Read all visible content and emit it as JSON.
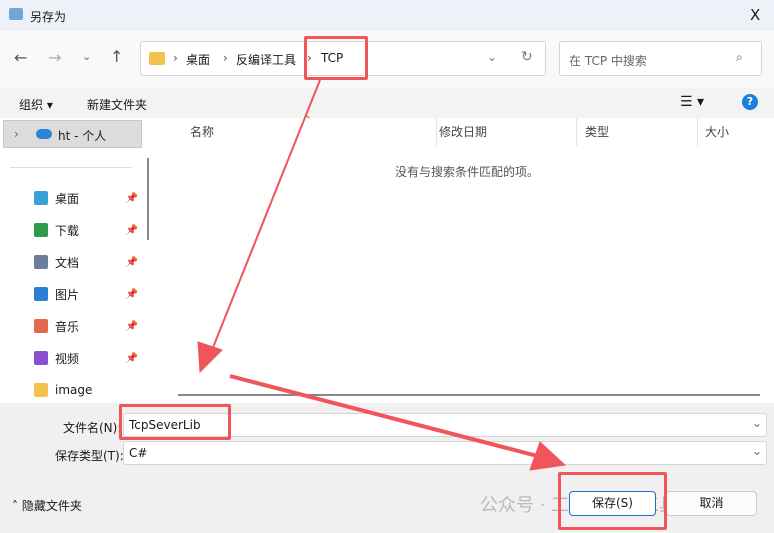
{
  "window": {
    "title": "另存为",
    "close": "X"
  },
  "nav": {
    "breadcrumb": [
      "桌面",
      "反编译工具",
      "TCP"
    ],
    "search_placeholder": "在 TCP 中搜索"
  },
  "toolbar": {
    "organize": "组织 ▾",
    "new_folder": "新建文件夹",
    "help": "?"
  },
  "sidebar": {
    "onedrive": "ht - 个人",
    "items": [
      {
        "label": "桌面",
        "icon": "desktop-icon",
        "color": "#3aa0d8"
      },
      {
        "label": "下载",
        "icon": "download-icon",
        "color": "#2e9a4a"
      },
      {
        "label": "文档",
        "icon": "document-icon",
        "color": "#6a7f9a"
      },
      {
        "label": "图片",
        "icon": "pictures-icon",
        "color": "#2b7fd4"
      },
      {
        "label": "音乐",
        "icon": "music-icon",
        "color": "#e0694f"
      },
      {
        "label": "视频",
        "icon": "video-icon",
        "color": "#8a4fd0"
      },
      {
        "label": "image",
        "icon": "folder-icon",
        "color": "#f2c14e"
      }
    ]
  },
  "columns": [
    "名称",
    "修改日期",
    "类型",
    "大小"
  ],
  "empty_message": "没有与搜索条件匹配的项。",
  "form": {
    "filename_label": "文件名(N):",
    "filename_value": "TcpSeverLib",
    "filetype_label": "保存类型(T):",
    "filetype_value": "C#"
  },
  "footer": {
    "hide_folders": "隐藏文件夹",
    "save": "保存(S)",
    "cancel": "取消"
  },
  "watermark": "公众号 · 工程师必备工具",
  "accent": "#f0555a"
}
